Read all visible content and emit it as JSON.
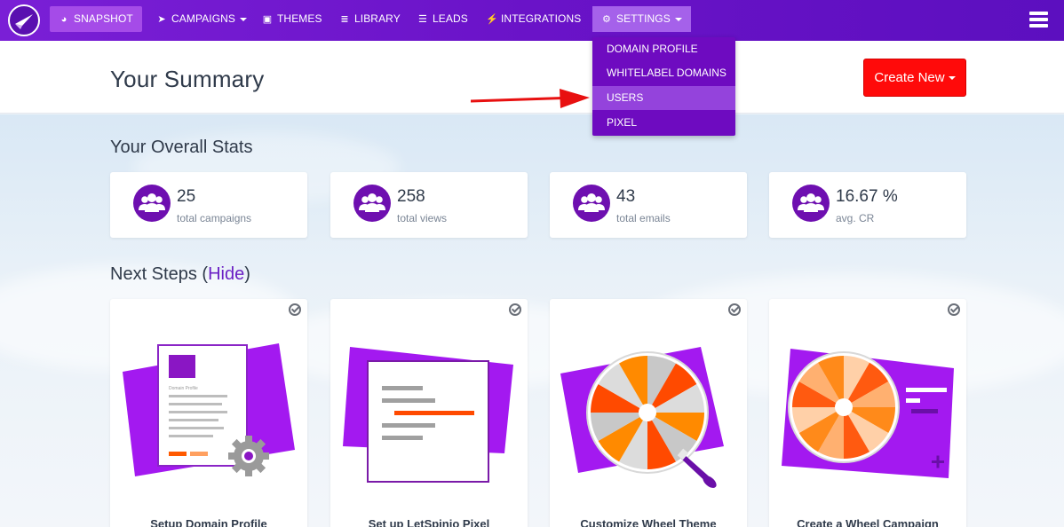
{
  "nav": {
    "items": [
      {
        "label": "Snapshot",
        "icon": "dashboard-icon"
      },
      {
        "label": "Campaigns",
        "icon": "paper-plane-icon"
      },
      {
        "label": "Themes",
        "icon": "image-icon"
      },
      {
        "label": "Library",
        "icon": "library-icon"
      },
      {
        "label": "Leads",
        "icon": "list-icon"
      },
      {
        "label": "Integrations",
        "icon": "plug-icon"
      },
      {
        "label": "Settings",
        "icon": "gears-icon"
      }
    ]
  },
  "settings_menu": {
    "items": [
      "Domain Profile",
      "Whitelabel Domains",
      "Users",
      "Pixel"
    ],
    "highlighted": "Users"
  },
  "header": {
    "title": "Your Summary",
    "create_label": "Create New"
  },
  "stats": {
    "title": "Your Overall Stats",
    "cards": [
      {
        "value": "25",
        "label": "total campaigns"
      },
      {
        "value": "258",
        "label": "total views"
      },
      {
        "value": "43",
        "label": "total emails"
      },
      {
        "value": "16.67 %",
        "label": "avg. CR"
      }
    ]
  },
  "next_steps": {
    "title": "Next Steps",
    "hide_open": "(",
    "hide_label": "Hide",
    "hide_close": ")",
    "cards": [
      {
        "label": "Setup Domain Profile"
      },
      {
        "label": "Set up LetSpinio Pixel"
      },
      {
        "label": "Customize Wheel Theme"
      },
      {
        "label": "Create a Wheel Campaign"
      }
    ],
    "illustration_text": "Domain Profile"
  },
  "colors": {
    "nav_bg": "#6a13c8",
    "accent_purple": "#6e0fb0",
    "create_button": "#ff0a0a",
    "annotation_arrow": "#e81010"
  }
}
